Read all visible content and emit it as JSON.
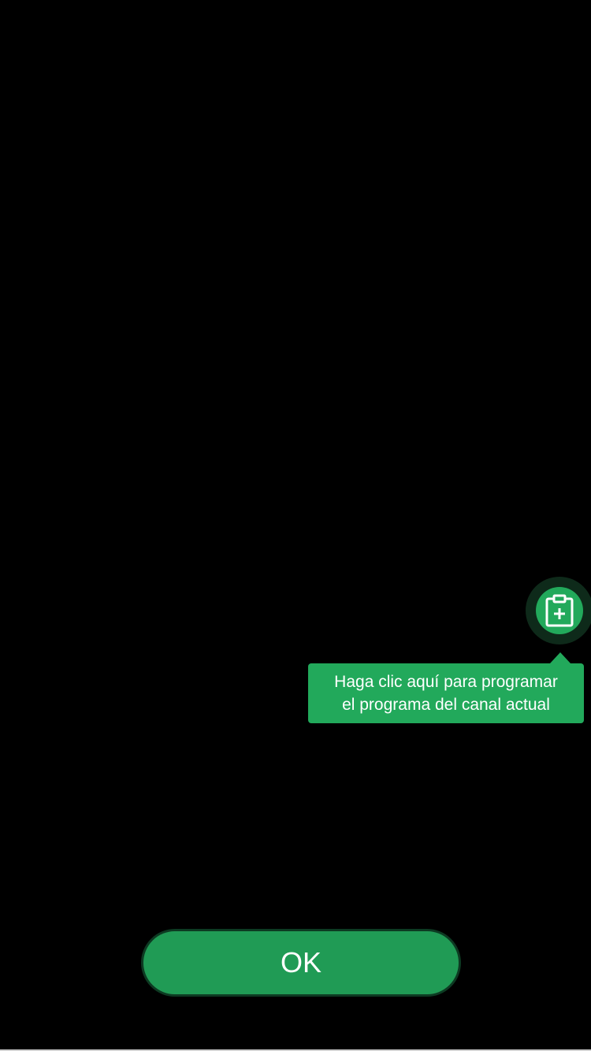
{
  "fab": {
    "icon": "clipboard-plus-icon"
  },
  "tooltip": {
    "line1": "Haga clic aquí para programar",
    "line2": "el programa del canal actual"
  },
  "ok_button": {
    "label": "OK"
  },
  "colors": {
    "background": "#000000",
    "accent": "#22a95b",
    "button": "#209b55",
    "ring": "#0e2a1a",
    "text": "#ffffff"
  }
}
